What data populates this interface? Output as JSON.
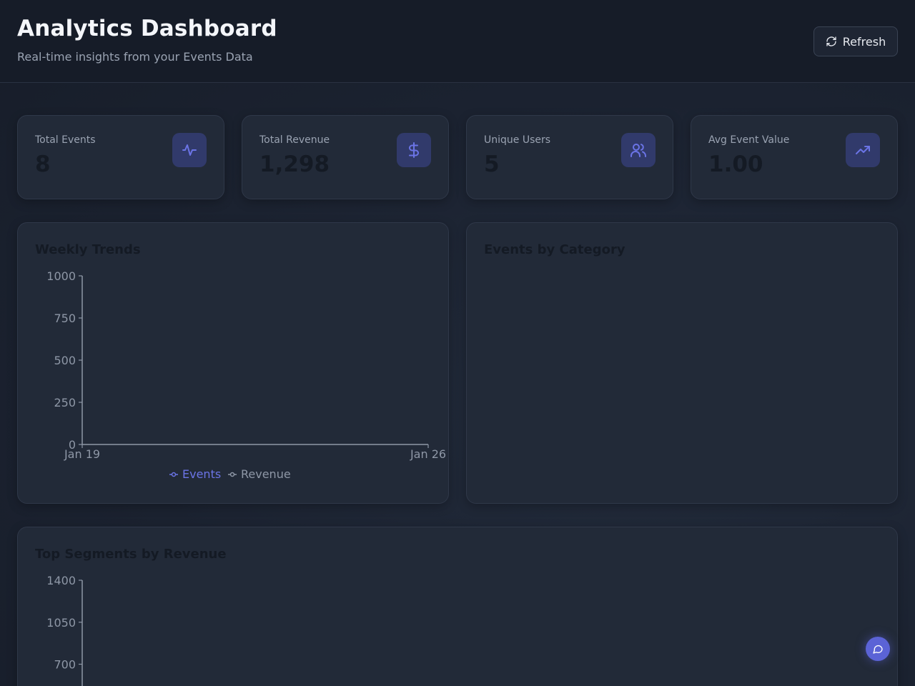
{
  "header": {
    "title": "Analytics Dashboard",
    "subtitle": "Real-time insights from your Events Data",
    "refresh_label": "Refresh"
  },
  "stats": [
    {
      "label": "Total Events",
      "value": "8",
      "icon": "activity-icon"
    },
    {
      "label": "Total Revenue",
      "value": "1,298",
      "icon": "dollar-icon"
    },
    {
      "label": "Unique Users",
      "value": "5",
      "icon": "users-icon"
    },
    {
      "label": "Avg Event Value",
      "value": "1.00",
      "icon": "trending-up-icon"
    }
  ],
  "colors": {
    "accent": "#6b74e6",
    "icon_bg": "#313a6b",
    "axis": "#8e97a6",
    "revenue": "#8e97a6"
  },
  "panels": {
    "weekly_trends": {
      "title": "Weekly Trends"
    },
    "events_by_category": {
      "title": "Events by Category"
    },
    "top_segments": {
      "title": "Top Segments by Revenue"
    }
  },
  "chart_data": [
    {
      "type": "line",
      "title": "Weekly Trends",
      "x": [
        "Jan 19",
        "Jan 26"
      ],
      "series": [
        {
          "name": "Events",
          "values": []
        },
        {
          "name": "Revenue",
          "values": []
        }
      ],
      "yticks": [
        "0",
        "250",
        "500",
        "750",
        "1000"
      ],
      "ylim": [
        0,
        1000
      ],
      "legend": "bottom",
      "grid": false
    },
    {
      "type": "pie",
      "title": "Events by Category",
      "categories": [],
      "values": []
    },
    {
      "type": "bar",
      "title": "Top Segments by Revenue",
      "categories": [],
      "values": [],
      "yticks": [
        "700",
        "1050",
        "1400"
      ],
      "ylim": [
        0,
        1400
      ],
      "grid": false
    }
  ]
}
